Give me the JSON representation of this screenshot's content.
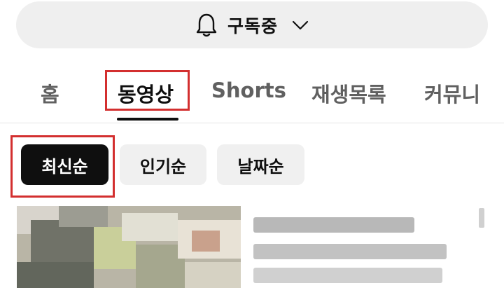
{
  "subscribe": {
    "label": "구독중"
  },
  "tabs": [
    {
      "label": "홈",
      "active": false
    },
    {
      "label": "동영상",
      "active": true
    },
    {
      "label": "Shorts",
      "active": false
    },
    {
      "label": "재생목록",
      "active": false
    },
    {
      "label": "커뮤니",
      "active": false
    }
  ],
  "chips": [
    {
      "label": "최신순",
      "active": true
    },
    {
      "label": "인기순",
      "active": false
    },
    {
      "label": "날짜순",
      "active": false
    }
  ],
  "colors": {
    "highlight": "#d32f2f",
    "chip_active_bg": "#0f0f0f",
    "chip_bg": "#f0f0f0",
    "bar_bg": "#efefef"
  }
}
